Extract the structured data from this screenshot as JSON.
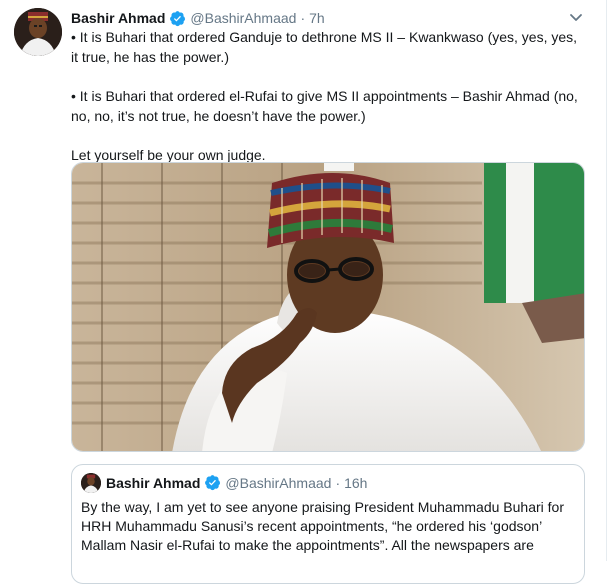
{
  "tweet": {
    "author_name": "Bashir Ahmad",
    "author_handle": "@BashirAhmaad",
    "separator": "·",
    "time": "7h",
    "paragraphs": [
      "• It is Buhari that ordered Ganduje to dethrone MS II – Kwankwaso (yes, yes, yes, it true, he has the power.)",
      "• It is Buhari that ordered el-Rufai to give MS II appointments – Bashir Ahmad (no, no, no, it’s not true, he doesn’t have the power.)",
      "Let yourself be your own judge."
    ]
  },
  "quote": {
    "author_name": "Bashir Ahmad",
    "author_handle": "@BashirAhmaad",
    "separator": "·",
    "time": "16h",
    "text": "By the way, I am yet to see anyone praising President Muhammadu Buhari for HRH Muhammadu Sanusi’s recent appointments, “he ordered his ‘godson’ Mallam Nasir el-Rufai to make the appointments”. All the newspapers are"
  },
  "icons": {
    "verified": "verified-badge-icon",
    "caret": "chevron-down-icon"
  },
  "colors": {
    "verified_blue": "#1da1f2",
    "secondary_text": "#657786",
    "border": "#ccd6dd"
  }
}
